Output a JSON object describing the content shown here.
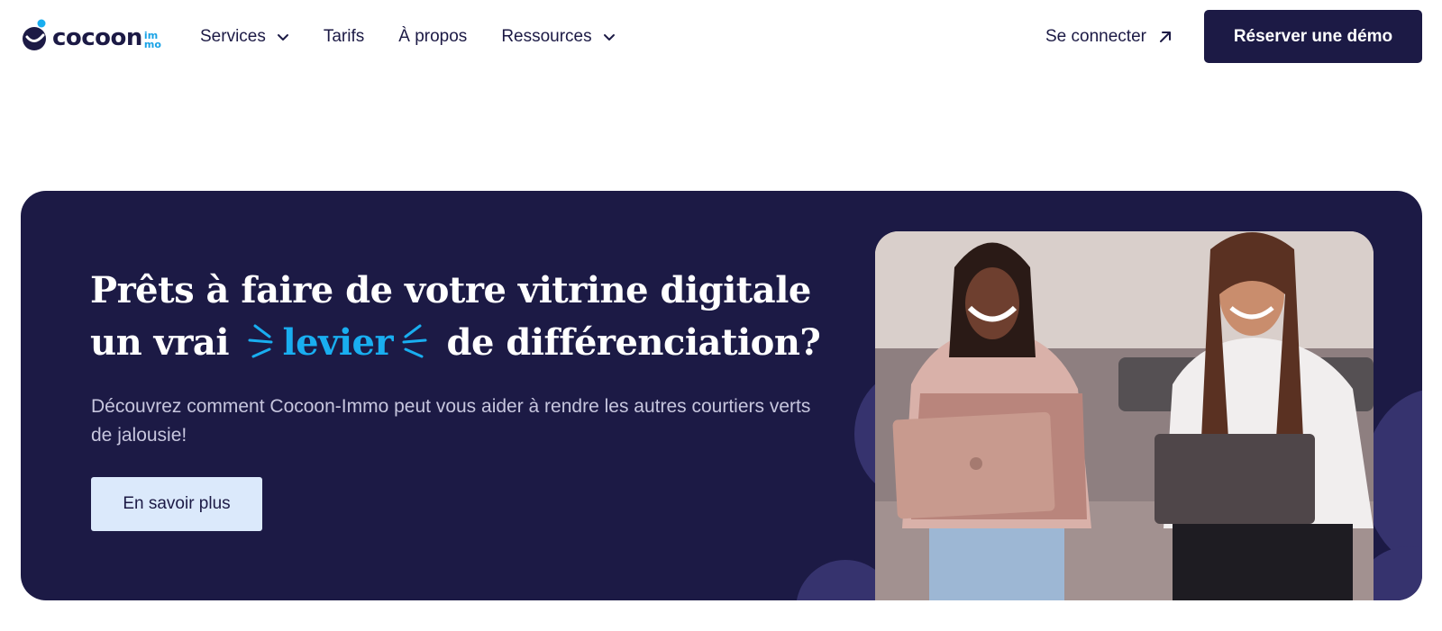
{
  "brand": {
    "name": "cocoon",
    "sub_top": "im",
    "sub_bottom": "mo",
    "colors": {
      "navy": "#1c1a45",
      "accent": "#19aef0",
      "cta_bg": "#dbe9fb"
    }
  },
  "nav": {
    "items": [
      {
        "label": "Services",
        "has_dropdown": true
      },
      {
        "label": "Tarifs",
        "has_dropdown": false
      },
      {
        "label": "À propos",
        "has_dropdown": false
      },
      {
        "label": "Ressources",
        "has_dropdown": true
      }
    ]
  },
  "header": {
    "login_label": "Se connecter",
    "demo_label": "Réserver une démo"
  },
  "banner": {
    "headline_line1": "Prêts à faire de votre vitrine digitale",
    "headline_pre": "un vrai",
    "headline_accent": "levier",
    "headline_post": "de différenciation?",
    "subtext": "Découvrez comment Cocoon-Immo peut vous aider à rendre les autres courtiers verts de jalousie!",
    "cta_label": "En savoir plus"
  },
  "icons": {
    "logo": "cocoon-logo-icon",
    "chevron": "chevron-down-icon",
    "arrow": "arrow-up-right-icon"
  }
}
